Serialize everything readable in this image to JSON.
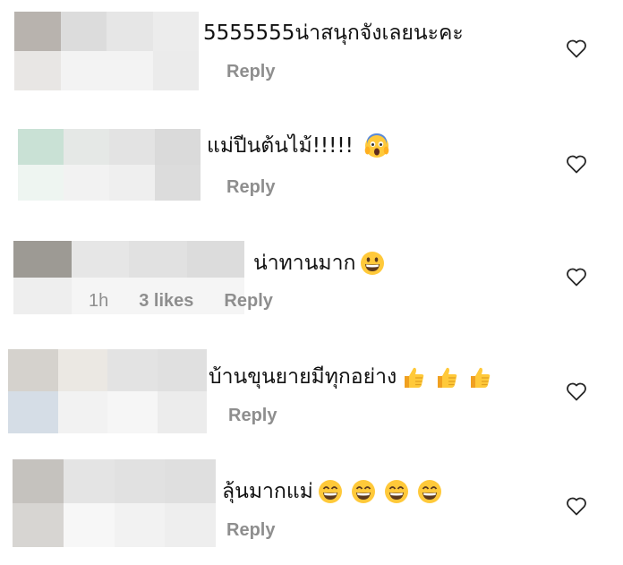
{
  "comments": [
    {
      "text": "5555555น่าสนุกจังเลยนะคะ",
      "emojis": [],
      "meta": {
        "time": "",
        "likes": "",
        "reply": "Reply"
      },
      "blur_colors": [
        "#b8b3ae",
        "#dcdcdc",
        "#e6e6e6",
        "#ececec",
        "#e8e6e4",
        "#f3f3f3",
        "#f3f3f3",
        "#ebebeb"
      ]
    },
    {
      "text": "แม่ปีนต้นไม้!!!!!",
      "emojis": [
        "scream-emoji"
      ],
      "meta": {
        "time": "",
        "likes": "",
        "reply": "Reply"
      },
      "blur_colors": [
        "#c9e1d5",
        "#e5e8e6",
        "#e3e3e3",
        "#dadada",
        "#eef5f1",
        "#f2f2f2",
        "#efefef",
        "#dcdcdc"
      ]
    },
    {
      "text": "น่าทานมาก",
      "emojis": [
        "grin-emoji"
      ],
      "meta": {
        "time": "1h",
        "likes": "3 likes",
        "reply": "Reply"
      },
      "blur_colors": [
        "#9d9a94",
        "#e6e6e6",
        "#e1e1e1",
        "#dcdcdc",
        "#eeeeee",
        "#f5f5f5",
        "#f5f5f5",
        "#f5f5f5"
      ]
    },
    {
      "text": "บ้านขุนยายมีทุกอย่าง",
      "emojis": [
        "thumbs-up-emoji",
        "thumbs-up-emoji",
        "thumbs-up-emoji"
      ],
      "meta": {
        "time": "",
        "likes": "",
        "reply": "Reply"
      },
      "blur_colors": [
        "#d5d2cd",
        "#ebe8e3",
        "#e3e3e3",
        "#e0e0e0",
        "#d5dde6",
        "#f2f2f2",
        "#f6f6f6",
        "#ececec"
      ]
    },
    {
      "text": "ลุ้นมากแม่",
      "emojis": [
        "grinning-squint-emoji",
        "grinning-squint-emoji",
        "grinning-squint-emoji",
        "grinning-squint-emoji"
      ],
      "meta": {
        "time": "",
        "likes": "",
        "reply": "Reply"
      },
      "blur_colors": [
        "#c5c2be",
        "#e4e4e4",
        "#e1e1e1",
        "#dfdfdf",
        "#d7d5d2",
        "#f7f7f7",
        "#f2f2f2",
        "#eeeeee"
      ]
    }
  ],
  "icons": {
    "like": "heart-outline-icon"
  },
  "colors": {
    "meta_text": "#8e8e8e",
    "heart_stroke": "#262626"
  }
}
